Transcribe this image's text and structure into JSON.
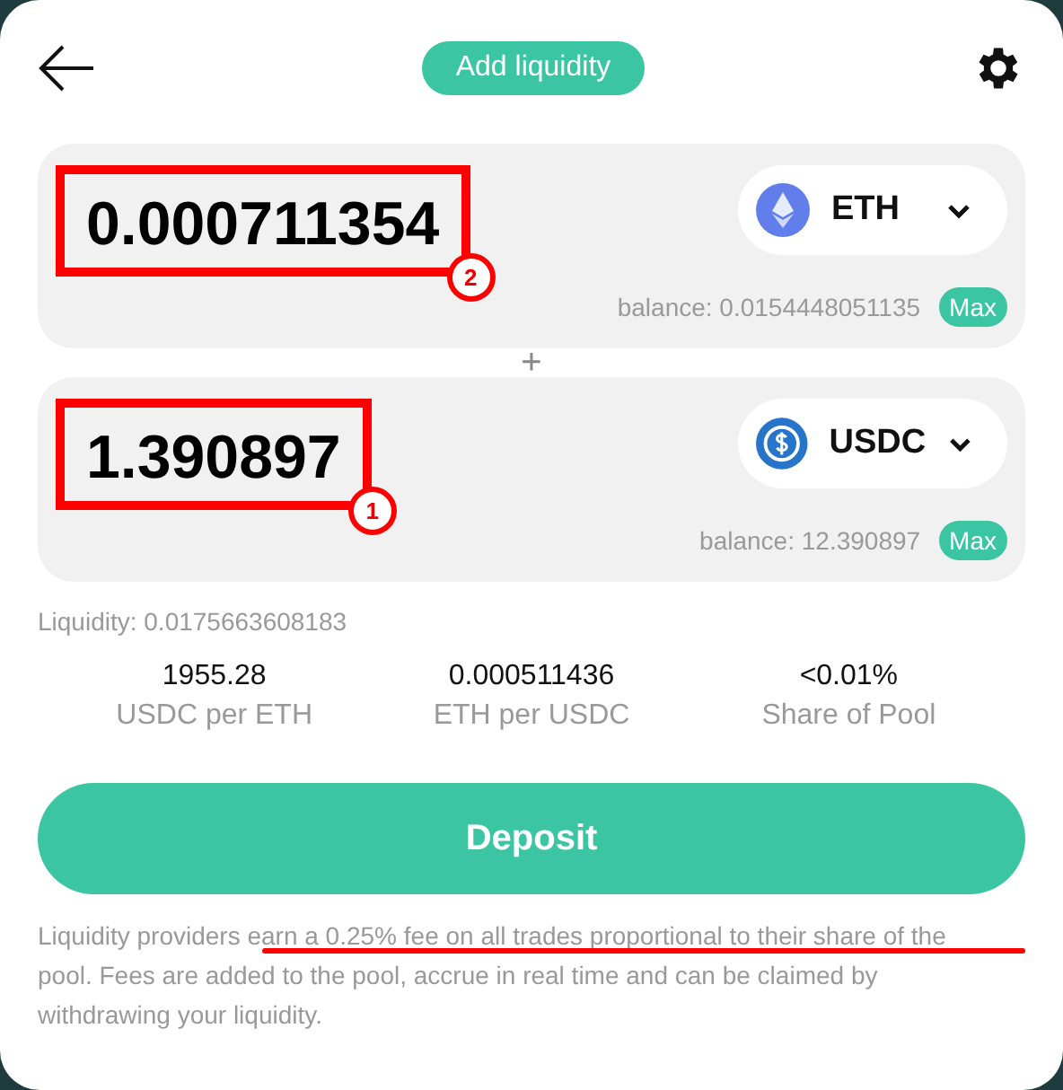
{
  "header": {
    "title": "Add liquidity"
  },
  "inputs": [
    {
      "amount": "0.000711354",
      "annotation_badge": "2",
      "token": "ETH",
      "kind": "eth",
      "balance": "balance: 0.0154448051135",
      "max_label": "Max"
    },
    {
      "amount": "1.390897",
      "annotation_badge": "1",
      "token": "USDC",
      "kind": "usdc",
      "balance": "balance: 12.390897",
      "max_label": "Max"
    }
  ],
  "separator": "+",
  "liquidity": "Liquidity: 0.0175663608183",
  "stats": [
    {
      "value": "1955.28",
      "label": "USDC per ETH"
    },
    {
      "value": "0.000511436",
      "label": "ETH per USDC"
    },
    {
      "value": "<0.01%",
      "label": "Share of Pool"
    }
  ],
  "deposit_button": "Deposit",
  "footer": {
    "text": "Liquidity providers earn a 0.25% fee on all trades proportional to their share of the pool. Fees are added to the pool, accrue in real time and can be claimed by withdrawing your liquidity.",
    "annotation": {
      "kind": "underline"
    }
  }
}
